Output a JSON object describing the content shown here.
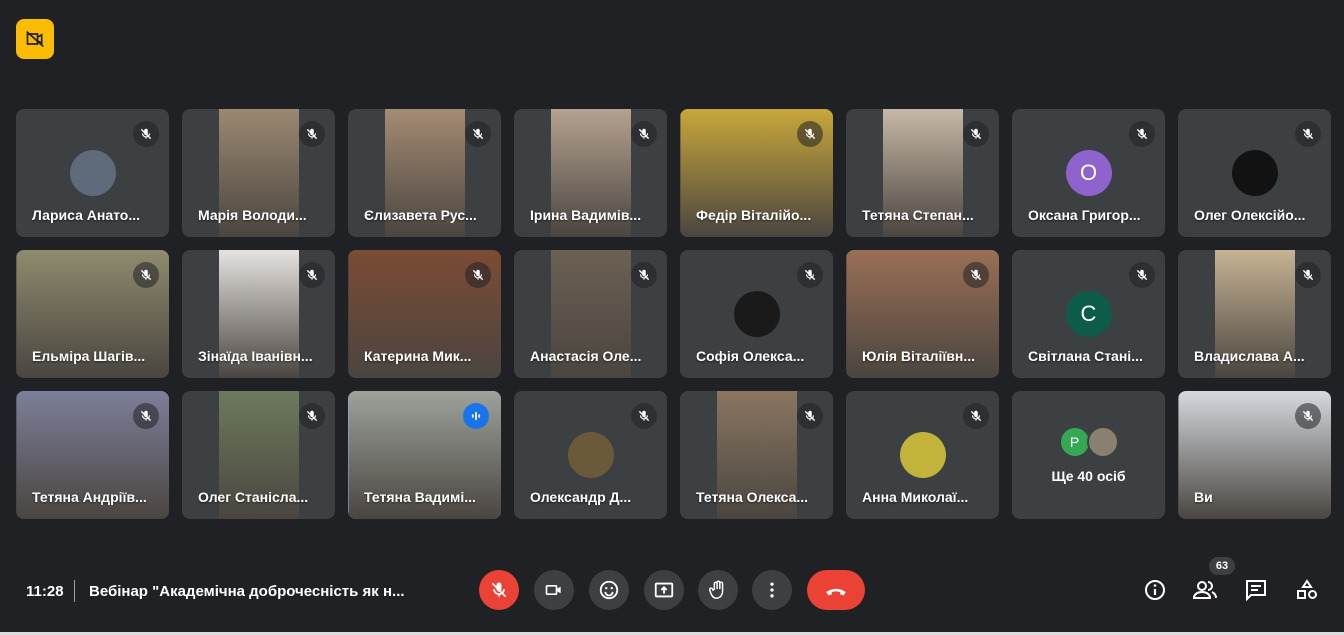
{
  "top_badge": {
    "icon": "camera-off-icon"
  },
  "participants": [
    {
      "name": "Лариса Анато...",
      "type": "avatar",
      "avatar_color": "#5f6b7a",
      "mic": "muted"
    },
    {
      "name": "Марія Володи...",
      "type": "video",
      "video_color": "#9c8872",
      "mic": "muted"
    },
    {
      "name": "Єлизавета Рус...",
      "type": "video",
      "video_color": "#a58b73",
      "mic": "muted"
    },
    {
      "name": "Ірина Вадимів...",
      "type": "video",
      "video_color": "#b5a290",
      "mic": "muted"
    },
    {
      "name": "Федір Віталійо...",
      "type": "video",
      "video_color": "#c9a73a",
      "mic": "muted",
      "wide": true
    },
    {
      "name": "Тетяна Степан...",
      "type": "video",
      "video_color": "#c7b8a6",
      "mic": "muted"
    },
    {
      "name": "Оксана Григор...",
      "type": "avatar",
      "avatar_letter": "О",
      "avatar_color": "#8e63ce",
      "mic": "muted"
    },
    {
      "name": "Олег Олексійо...",
      "type": "avatar",
      "avatar_color": "#121212",
      "mic": "muted"
    },
    {
      "name": "Ельміра Шагів...",
      "type": "video",
      "video_color": "#8f8b6e",
      "mic": "muted",
      "wide": true
    },
    {
      "name": "Зінаїда Іванівн...",
      "type": "video",
      "video_color": "#e6e2df",
      "mic": "muted"
    },
    {
      "name": "Катерина Мик...",
      "type": "video",
      "video_color": "#7c4b35",
      "mic": "muted",
      "wide": true
    },
    {
      "name": "Анастасія Оле...",
      "type": "video",
      "video_color": "#6c6053",
      "mic": "muted"
    },
    {
      "name": "Софія Олекса...",
      "type": "avatar",
      "avatar_color": "#1a1a1a",
      "mic": "muted"
    },
    {
      "name": "Юлія Віталіївн...",
      "type": "video",
      "video_color": "#9a6f55",
      "mic": "muted",
      "wide": true
    },
    {
      "name": "Світлана Стані...",
      "type": "avatar",
      "avatar_letter": "С",
      "avatar_color": "#0d5c4a",
      "mic": "muted"
    },
    {
      "name": "Владислава А...",
      "type": "video",
      "video_color": "#c7b394",
      "mic": "muted"
    },
    {
      "name": "Тетяна Андріїв...",
      "type": "video",
      "video_color": "#7d7f9a",
      "mic": "muted",
      "wide": true
    },
    {
      "name": "Олег Станісла...",
      "type": "video",
      "video_color": "#6d7a5c",
      "mic": "muted"
    },
    {
      "name": "Тетяна Вадимі...",
      "type": "video",
      "video_color": "#9ca39a",
      "mic": "speaking",
      "wide": true,
      "active": true
    },
    {
      "name": "Олександр Д...",
      "type": "avatar",
      "avatar_color": "#6b5a3a",
      "mic": "muted"
    },
    {
      "name": "Тетяна Олекса...",
      "type": "video",
      "video_color": "#8a7660",
      "mic": "muted"
    },
    {
      "name": "Анна Миколаї...",
      "type": "avatar",
      "avatar_color": "#c2b33a",
      "mic": "muted"
    },
    {
      "name": "",
      "type": "more"
    },
    {
      "name": "Ви",
      "type": "video",
      "video_color": "#d5d9de",
      "mic": "muted",
      "wide": true
    }
  ],
  "more_tile": {
    "text": "Ще 40 осіб",
    "avatar_letter": "Р",
    "avatar_color": "#34a853",
    "avatar2_color": "#8a8070"
  },
  "bottom_bar": {
    "time": "11:28",
    "meeting_title": "Вебінар \"Академічна доброчесність як н...",
    "participant_count": "63",
    "colors": {
      "end_call": "#ea4335",
      "mic_off": "#ea4335"
    }
  }
}
